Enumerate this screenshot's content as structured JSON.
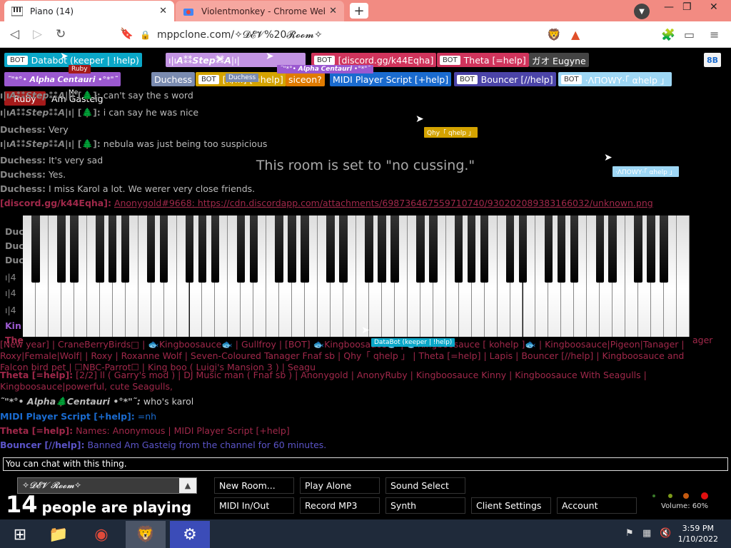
{
  "browser": {
    "tabs": [
      {
        "title": "Piano (14)",
        "active": true
      },
      {
        "title": "Violentmonkey - Chrome Web Store",
        "active": false
      }
    ],
    "url": "mppclone.com/✧𝓓𝓔𝓥%20𝓡𝓸𝓸𝓶✧"
  },
  "room": {
    "nametags": [
      {
        "label": "Databot (keeper | !help)",
        "bot": true,
        "color": "#0aa7c8"
      },
      {
        "label": "ı|ı𝘼⁑⁑𝙎𝙩𝙚𝙥⁑⁑𝘼|ı|",
        "bot": false,
        "color": "#c394e3"
      },
      {
        "label": "[discord.gg/k44Eqha]",
        "bot": true,
        "color": "#d0345c"
      },
      {
        "label": "Theta [=help]",
        "bot": true,
        "color": "#d0345c"
      },
      {
        "label": "ガオ Eugyne",
        "bot": false,
        "color": "#444444"
      },
      {
        "label": "˜\"*°• 𝘼𝙡𝙥𝙝𝙖 𝘾𝙚𝙣𝙩𝙖𝙪𝙧𝙞 •°*\"˜",
        "bot": false,
        "color": "#9b59d0"
      },
      {
        "label": "Duchess",
        "bot": false,
        "color": "#7a8bb0"
      },
      {
        "label": "[n/...] [=help]",
        "bot": true,
        "color": "#d4a300"
      },
      {
        "label": "siceon?",
        "bot": false,
        "color": "#e07b00"
      },
      {
        "label": "MIDI Player Script [+help]",
        "bot": false,
        "color": "#1a6bcf"
      },
      {
        "label": "Bouncer [//help]",
        "bot": true,
        "color": "#4b44a8"
      },
      {
        "label": "·ΛΠΟWΥ·「 αhelp 」",
        "bot": true,
        "color": "#9ed7f5"
      },
      {
        "label": "Ruby",
        "bot": false,
        "color": "#a51a1a"
      },
      {
        "label": "Am Gasteig",
        "bot": false,
        "color": "#000000"
      }
    ],
    "user_count_badge": "8B",
    "overlay_labels": {
      "ruby": "Ruby",
      "me": "Me",
      "duchess": "Duchess",
      "alpha_small": "˜\"*°• 𝘼𝙡𝙥𝙝𝙖 𝘾𝙚𝙣𝙩𝙖𝙪𝙧𝙞 •°*\"˜",
      "qhy": "Qhy「 qhelp 」",
      "anowy": "·ΛΠΟWΥ·「 αhelp 」",
      "databot": "DataBot (keeper | !help)"
    },
    "notice": "This room is set to \"no cussing.\"",
    "messages": [
      {
        "name": "ı|ı𝘼⁑⁑𝙎𝙩𝙚𝙥⁑⁑𝘼|ı| [🌲]:",
        "text": "can't say the s word",
        "color": "#888888"
      },
      {
        "name": "ı|ı𝘼⁑⁑𝙎𝙩𝙚𝙥⁑⁑𝘼|ı| [🌲]:",
        "text": "i can say he was nice",
        "color": "#888888"
      },
      {
        "name": "Duchess:",
        "text": "Very",
        "color": "#888888"
      },
      {
        "name": "ı|ı𝘼⁑⁑𝙎𝙩𝙚𝙥⁑⁑𝘼|ı| [🌲]:",
        "text": "nebula was just being too suspicious",
        "color": "#888888"
      },
      {
        "name": "Duchess:",
        "text": "It's very sad",
        "color": "#888888"
      },
      {
        "name": "Duchess:",
        "text": "Yes.",
        "color": "#888888"
      },
      {
        "name": "Duchess:",
        "text": "I miss Karol a lot. We werer very close friends.",
        "color": "#888888"
      },
      {
        "name": "[discord.gg/k44Eqha]:",
        "text": "Anonygold#9668: https://cdn.discordapp.com/attachments/698736467559710740/930202089383166032/unknown.png",
        "color": "#a0284a"
      }
    ],
    "messages_lower": [
      {
        "name": "",
        "text": "[New year] | CraneBerryBirds□ | 🐟Kingboosauce🐟 | Gullfroy | [BOT] 🐟Kingboosauce🐟 | 🐟Kingboosauce [ kohelp ]🐟 | Kingboosauce|Pigeon|Tanager | Roxy|Female|Wolf| | Roxy | Roxanne Wolf | Seven-Coloured Tanager Fnaf sb | Qhy「 qhelp 」 | Theta [=help] | Lapis | Bouncer [//help] | Kingboosauce and Falcon bird pet | ☐NBC-Parrot☐ | King boo ( Luigi's Mansion 3 ) | Seagu",
        "color": "#a0284a"
      },
      {
        "name": "Theta [=help]:",
        "text": "[2/2] ll ( Garry's mod ) | DJ Music man ( Fnaf sb ) | Anonygold | AnonyRuby | Kingboosauce Kinny | Kingboosauce With Seagulls | Kingboosauce|powerful, cute Seagulls,",
        "color": "#a0284a"
      },
      {
        "name": "˜\"*°• 𝘼𝙡𝙥𝙝𝙖🌲𝘾𝙚𝙣𝙩𝙖𝙪𝙧𝙞 •°*\"˜:",
        "text": "who's karol",
        "color": "#bbbbbb"
      },
      {
        "name": "MIDI Player Script [+help]:",
        "text": "=nh",
        "color": "#1a6bcf"
      },
      {
        "name": "Theta [=help]:",
        "text": "Names: Anonymous | MIDI Player Script [+help]",
        "color": "#a0284a"
      },
      {
        "name": "Bouncer [//help]:",
        "text": "Banned Am Gasteig from the channel for 60 minutes.",
        "color": "#5b54c8"
      }
    ],
    "left_fragments": [
      "Duc",
      "Duc",
      "Duc",
      "ı|4",
      "ı|4",
      "ı|4",
      "Kin",
      "The"
    ],
    "right_fragment": "ager"
  },
  "chat": {
    "placeholder": "You can chat with this thing."
  },
  "controls": {
    "room_name": "✧𝓓𝓔𝓥 𝓡𝓸𝓸𝓶✧",
    "count": "14",
    "count_label": "people are playing",
    "buttons_row1": [
      "New Room...",
      "Play Alone",
      "Sound Select"
    ],
    "buttons_row2": [
      "MIDI In/Out",
      "Record MP3",
      "Synth",
      "Client Settings",
      "Account"
    ],
    "volume": "Volume: 60%"
  },
  "taskbar": {
    "time": "3:59 PM",
    "date": "1/10/2022"
  }
}
